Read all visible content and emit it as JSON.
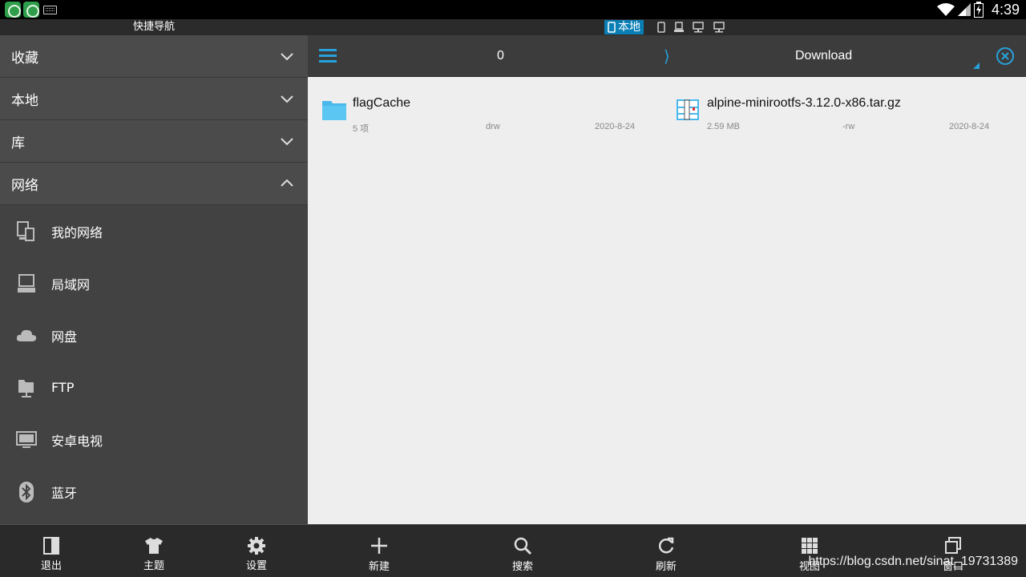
{
  "status_bar": {
    "time": "4:39"
  },
  "drawer": {
    "title": "快捷导航",
    "sections": [
      {
        "label": "收藏",
        "expanded": false
      },
      {
        "label": "本地",
        "expanded": false
      },
      {
        "label": "库",
        "expanded": false
      },
      {
        "label": "网络",
        "expanded": true
      }
    ],
    "network_items": [
      {
        "label": "我的网络",
        "icon": "my-network-icon"
      },
      {
        "label": "局域网",
        "icon": "lan-computer-icon"
      },
      {
        "label": "网盘",
        "icon": "cloud-icon"
      },
      {
        "label": "FTP",
        "icon": "ftp-folder-icon"
      },
      {
        "label": "安卓电视",
        "icon": "tv-icon"
      },
      {
        "label": "蓝牙",
        "icon": "bluetooth-icon"
      }
    ],
    "bottom": {
      "exit": "退出",
      "theme": "主题",
      "settings": "设置"
    }
  },
  "window_tabs": {
    "active_label": "本地"
  },
  "toolbar": {
    "count": "0",
    "separator": "⟩",
    "path": "Download"
  },
  "files": [
    {
      "name": "flagCache",
      "count": "5 项",
      "perm": "drw",
      "date": "2020-8-24",
      "icon": "folder-icon"
    },
    {
      "name": "alpine-minirootfs-3.12.0-x86.tar.gz",
      "size": "2.59 MB",
      "perm": "-rw",
      "date": "2020-8-24",
      "icon": "archive-icon"
    }
  ],
  "bottom_bar": {
    "new": "新建",
    "search": "搜索",
    "refresh": "刷新",
    "view": "视图",
    "window": "窗口"
  },
  "watermark": "https://blog.csdn.net/sinat_19731389",
  "colors": {
    "accent": "#27a2dc",
    "tab_active": "#0a7fb5",
    "drawer_bg": "#424242"
  }
}
